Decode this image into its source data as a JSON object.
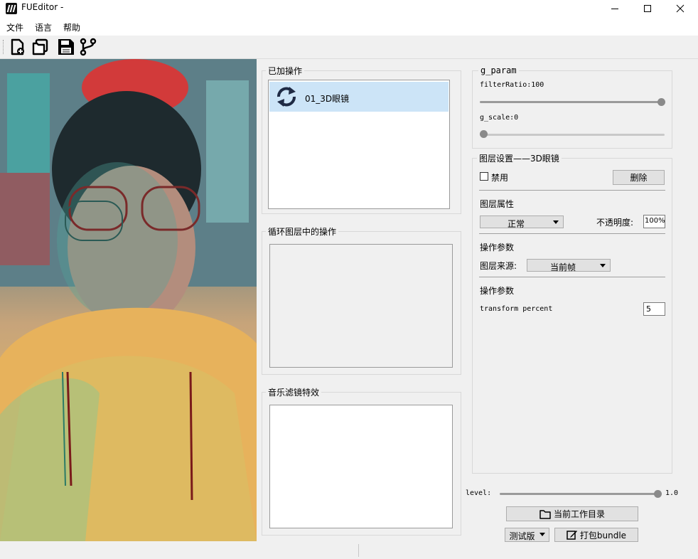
{
  "window": {
    "title": "FUEditor -"
  },
  "menu": [
    "文件",
    "语言",
    "帮助"
  ],
  "toolbar": {
    "icons": [
      "new-file-icon",
      "open-folder-icon",
      "save-icon",
      "branch-icon"
    ]
  },
  "added_ops": {
    "title": "已加操作",
    "items": [
      {
        "label": "01_3D眼镜",
        "icon": "refresh-icon",
        "selected": true
      }
    ]
  },
  "loop_ops": {
    "title": "循环图层中的操作"
  },
  "music": {
    "title": "音乐滤镜特效"
  },
  "gparam": {
    "title": "g_param",
    "filter_label": "filterRatio:100",
    "filter_value": 100,
    "scale_label": "g_scale:0",
    "scale_value": 0
  },
  "layer": {
    "title": "图层设置——3D眼镜",
    "disable_label": "禁用",
    "disabled": false,
    "delete_label": "删除",
    "attr_title": "图层属性",
    "blend_mode": "正常",
    "opacity_label": "不透明度:",
    "opacity_value": "100%",
    "op_params_title": "操作参数",
    "source_label": "图层来源:",
    "source_value": "当前帧",
    "op_params_title2": "操作参数",
    "transform_label": "transform percent",
    "transform_value": "5"
  },
  "level": {
    "label": "level:",
    "value": 1.0,
    "value_text": "1.0"
  },
  "buttons": {
    "workdir_label": "当前工作目录",
    "version_value": "测试版",
    "bundle_label": "打包bundle"
  },
  "colors": {
    "selection": "#cce4f7",
    "accent": "#1f2a44"
  }
}
